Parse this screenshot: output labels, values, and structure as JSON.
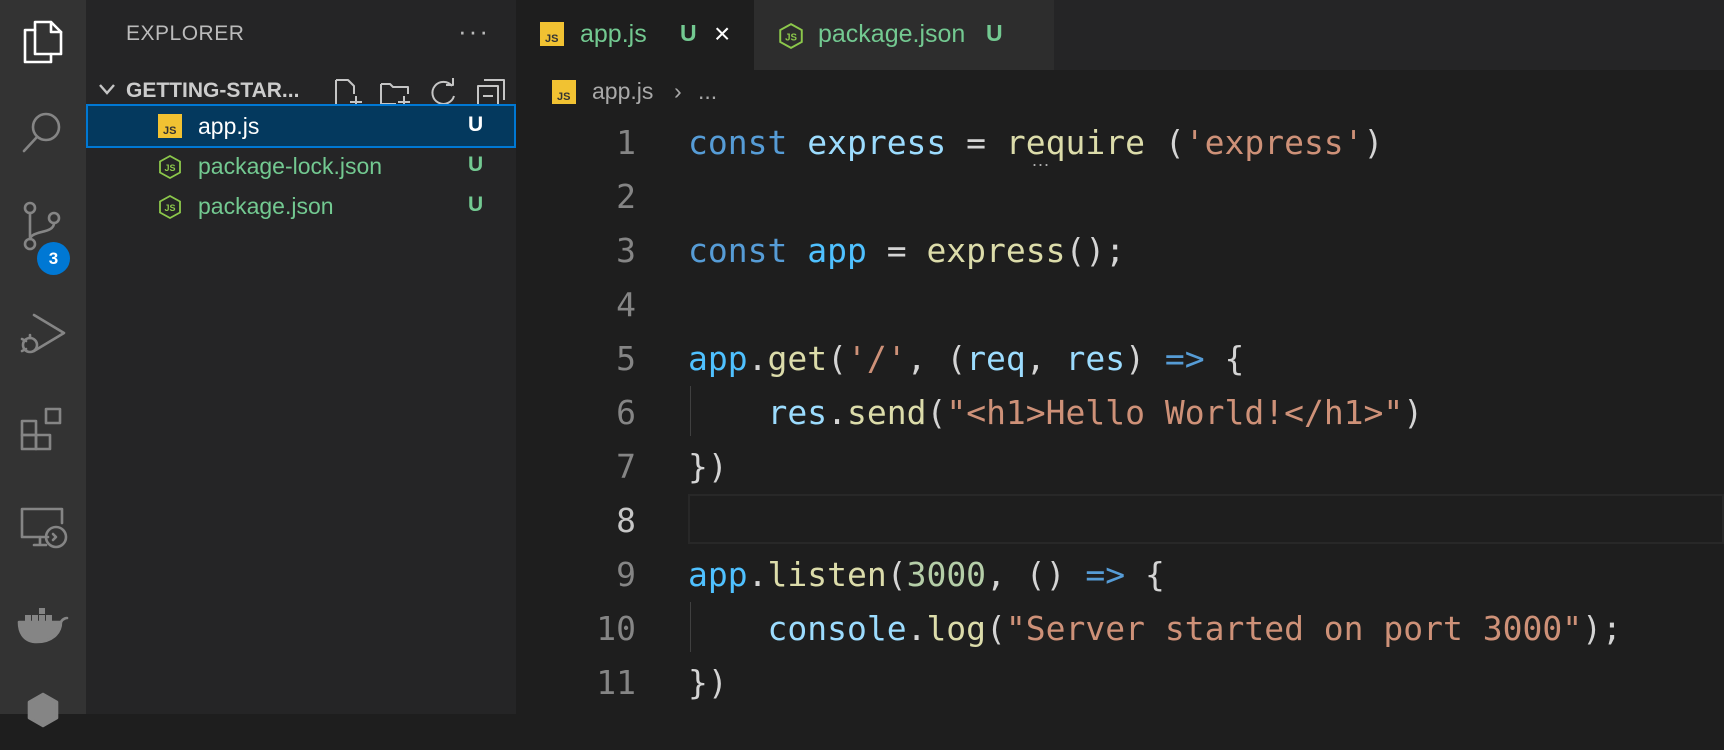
{
  "activity_bar": {
    "items": [
      {
        "icon": "files-icon",
        "active": true
      },
      {
        "icon": "search-icon",
        "active": false
      },
      {
        "icon": "source-control-icon",
        "active": false,
        "badge": "3"
      },
      {
        "icon": "run-debug-icon",
        "active": false
      },
      {
        "icon": "extensions-icon",
        "active": false
      },
      {
        "icon": "remote-explorer-icon",
        "active": false
      },
      {
        "icon": "docker-icon",
        "active": false
      },
      {
        "icon": "kubernetes-icon",
        "active": false
      }
    ]
  },
  "sidebar": {
    "title": "EXPLORER",
    "more": "···",
    "folder": "GETTING-STAR...",
    "files": [
      {
        "name": "app.js",
        "status": "U",
        "type": "js",
        "selected": true,
        "color": "#ffffff"
      },
      {
        "name": "package-lock.json",
        "status": "U",
        "type": "node",
        "selected": false,
        "color": "#73c991"
      },
      {
        "name": "package.json",
        "status": "U",
        "type": "node",
        "selected": false,
        "color": "#73c991"
      }
    ]
  },
  "tabs": [
    {
      "name": "app.js",
      "status": "U",
      "active": true,
      "close": "×"
    },
    {
      "name": "package.json",
      "status": "U",
      "active": false
    }
  ],
  "breadcrumb": {
    "file": "app.js",
    "separator": "›",
    "more": "..."
  },
  "editor": {
    "current_line": 8,
    "line_numbers": [
      "1",
      "2",
      "3",
      "4",
      "5",
      "6",
      "7",
      "8",
      "9",
      "10",
      "11"
    ],
    "lines": [
      [
        [
          "k",
          "const"
        ],
        [
          "p",
          " "
        ],
        [
          "v",
          "express"
        ],
        [
          "p",
          " = "
        ],
        [
          "f",
          "require"
        ],
        [
          "p",
          " ("
        ],
        [
          "s",
          "'express'"
        ],
        [
          "p",
          ")"
        ]
      ],
      [],
      [
        [
          "k",
          "const"
        ],
        [
          "p",
          " "
        ],
        [
          "c",
          "app"
        ],
        [
          "p",
          " = "
        ],
        [
          "f",
          "express"
        ],
        [
          "p",
          "();"
        ]
      ],
      [],
      [
        [
          "c",
          "app"
        ],
        [
          "p",
          "."
        ],
        [
          "f",
          "get"
        ],
        [
          "p",
          "("
        ],
        [
          "s",
          "'/'"
        ],
        [
          "p",
          ", ("
        ],
        [
          "v",
          "req"
        ],
        [
          "p",
          ", "
        ],
        [
          "v",
          "res"
        ],
        [
          "p",
          ") "
        ],
        [
          "k",
          "=>"
        ],
        [
          "p",
          " {"
        ]
      ],
      [
        [
          "p",
          "    "
        ],
        [
          "v",
          "res"
        ],
        [
          "p",
          "."
        ],
        [
          "f",
          "send"
        ],
        [
          "p",
          "("
        ],
        [
          "s",
          "\"<h1>Hello World!</h1>\""
        ],
        [
          "p",
          ")"
        ]
      ],
      [
        [
          "p",
          "})"
        ]
      ],
      [],
      [
        [
          "c",
          "app"
        ],
        [
          "p",
          "."
        ],
        [
          "f",
          "listen"
        ],
        [
          "p",
          "("
        ],
        [
          "n",
          "3000"
        ],
        [
          "p",
          ", () "
        ],
        [
          "k",
          "=>"
        ],
        [
          "p",
          " {"
        ]
      ],
      [
        [
          "p",
          "    "
        ],
        [
          "v",
          "console"
        ],
        [
          "p",
          "."
        ],
        [
          "f",
          "log"
        ],
        [
          "p",
          "("
        ],
        [
          "s",
          "\"Server started on port 3000\""
        ],
        [
          "p",
          ");"
        ]
      ],
      [
        [
          "p",
          "})"
        ]
      ]
    ],
    "hint": "..."
  }
}
